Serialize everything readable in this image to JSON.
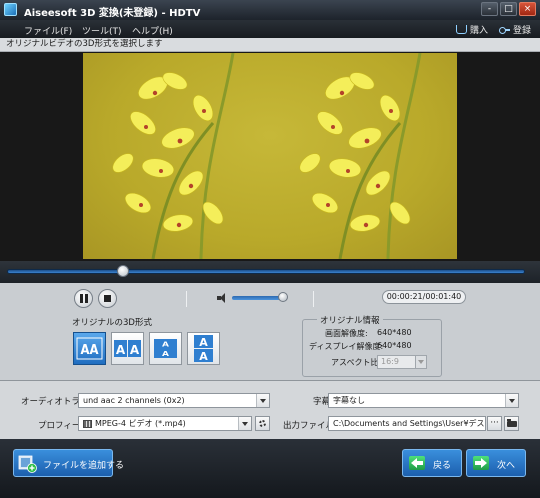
{
  "window": {
    "title": "Aiseesoft 3D 変換(未登録) - HDTV",
    "buttons": [
      "-",
      "□",
      "×"
    ]
  },
  "menu": {
    "items": [
      "ファイル(F)",
      "ツール(T)",
      "ヘルプ(H)"
    ],
    "purchase_label": "購入",
    "register_label": "登録"
  },
  "instruction": "オリジナルビデオの3D形式を選択します",
  "player": {
    "time_display": "00:00:21/00:01:40",
    "progress_fraction": 0.22,
    "volume_fraction": 0.85
  },
  "source_format": {
    "label": "オリジナルの3D形式",
    "modes": [
      {
        "icon": "side-by-side-half-icon",
        "selected": true
      },
      {
        "icon": "side-by-side-full-icon",
        "selected": false
      },
      {
        "icon": "top-bottom-half-icon",
        "selected": false
      },
      {
        "icon": "top-bottom-full-icon",
        "selected": false
      }
    ]
  },
  "original_info": {
    "title": "オリジナル情報",
    "resolution_label": "画面解像度:",
    "resolution_value": "640*480",
    "display_resolution_label": "ディスプレイ解像度:",
    "display_resolution_value": "640*480",
    "aspect_label": "アスペクト比:",
    "aspect_value": "16:9"
  },
  "settings": {
    "audio_track_label": "オーディオトラック",
    "audio_track_value": "und aac 2 channels (0x2)",
    "subtitle_label": "字幕",
    "subtitle_value": "字幕なし",
    "profile_label": "プロフィール",
    "profile_value": "MPEG-4 ビデオ (*.mp4)",
    "output_label": "出力ファイル",
    "output_value": "C:\\Documents and Settings\\User¥デスクトップ",
    "browse_label": "···"
  },
  "bottom": {
    "add_file_label": "ファイルを追加する",
    "back_label": "戻る",
    "next_label": "次へ"
  },
  "colors": {
    "accent_blue": "#2a7bd0",
    "dark_chrome": "#1d232b",
    "panel_gray": "#c9cdd1",
    "video_yellow": "#b9a92a"
  }
}
